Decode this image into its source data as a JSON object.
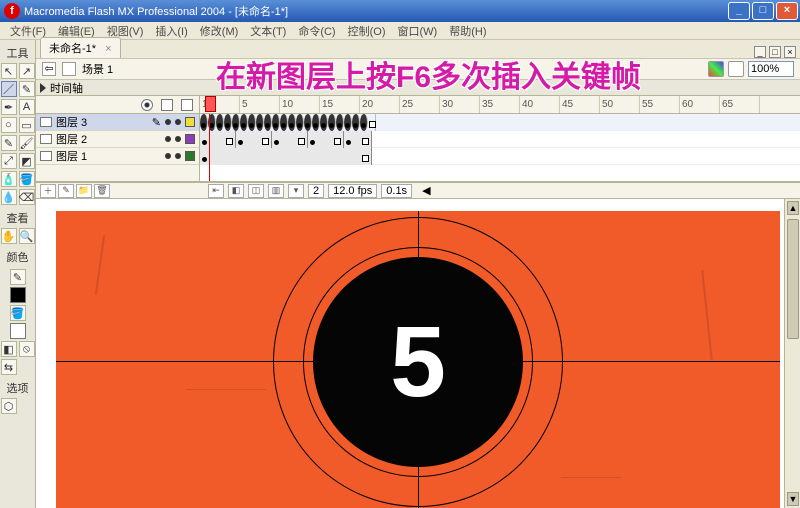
{
  "window": {
    "title": "Macromedia Flash MX Professional 2004 - [未命名-1*]"
  },
  "menu": {
    "file": "文件(F)",
    "edit": "编辑(E)",
    "view": "视图(V)",
    "insert": "插入(I)",
    "modify": "修改(M)",
    "text": "文本(T)",
    "commands": "命令(C)",
    "control": "控制(O)",
    "window": "窗口(W)",
    "help": "帮助(H)"
  },
  "document_tab": {
    "label": "未命名-1*"
  },
  "scene": {
    "label": "场景 1",
    "zoom": "100%"
  },
  "toolbox_labels": {
    "tools": "工具",
    "view": "查看",
    "colors": "颜色",
    "options": "选项"
  },
  "timeline_header": {
    "label": "时间轴"
  },
  "ruler_marks": [
    "1",
    "5",
    "10",
    "15",
    "20",
    "25",
    "30",
    "35",
    "40",
    "45",
    "50",
    "55",
    "60",
    "65"
  ],
  "layers": [
    {
      "name": "图层 3",
      "selected": true,
      "color": "#f1dd3a"
    },
    {
      "name": "图层 2",
      "selected": false,
      "color": "#8e3db8"
    },
    {
      "name": "图层 1",
      "selected": false,
      "color": "#2c7a2c"
    }
  ],
  "status": {
    "frame": "2",
    "fps": "12.0 fps",
    "time": "0.1s"
  },
  "stage": {
    "countdown": "5"
  },
  "annotation": {
    "text": "在新图层上按F6多次插入关键帧"
  }
}
